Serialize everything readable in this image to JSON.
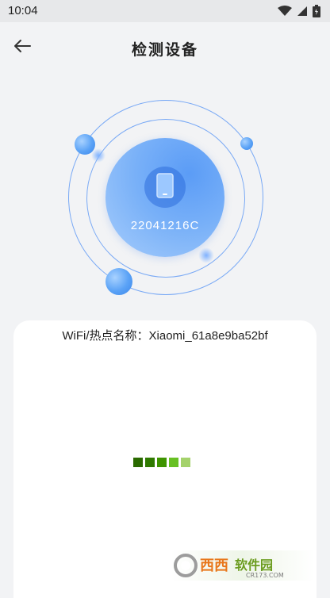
{
  "status_bar": {
    "time": "10:04"
  },
  "header": {
    "title": "检测设备"
  },
  "device": {
    "name": "22041216C"
  },
  "wifi": {
    "label": "WiFi/热点名称：Xiaomi_61a8e9ba52bf"
  },
  "loader": {
    "segment_colors": [
      "#2a6a00",
      "#2f7a00",
      "#3e9400",
      "#67c023",
      "#a4d26b"
    ]
  },
  "watermark": {
    "text_main": "西西软件园",
    "text_sub": "CR173.COM"
  }
}
